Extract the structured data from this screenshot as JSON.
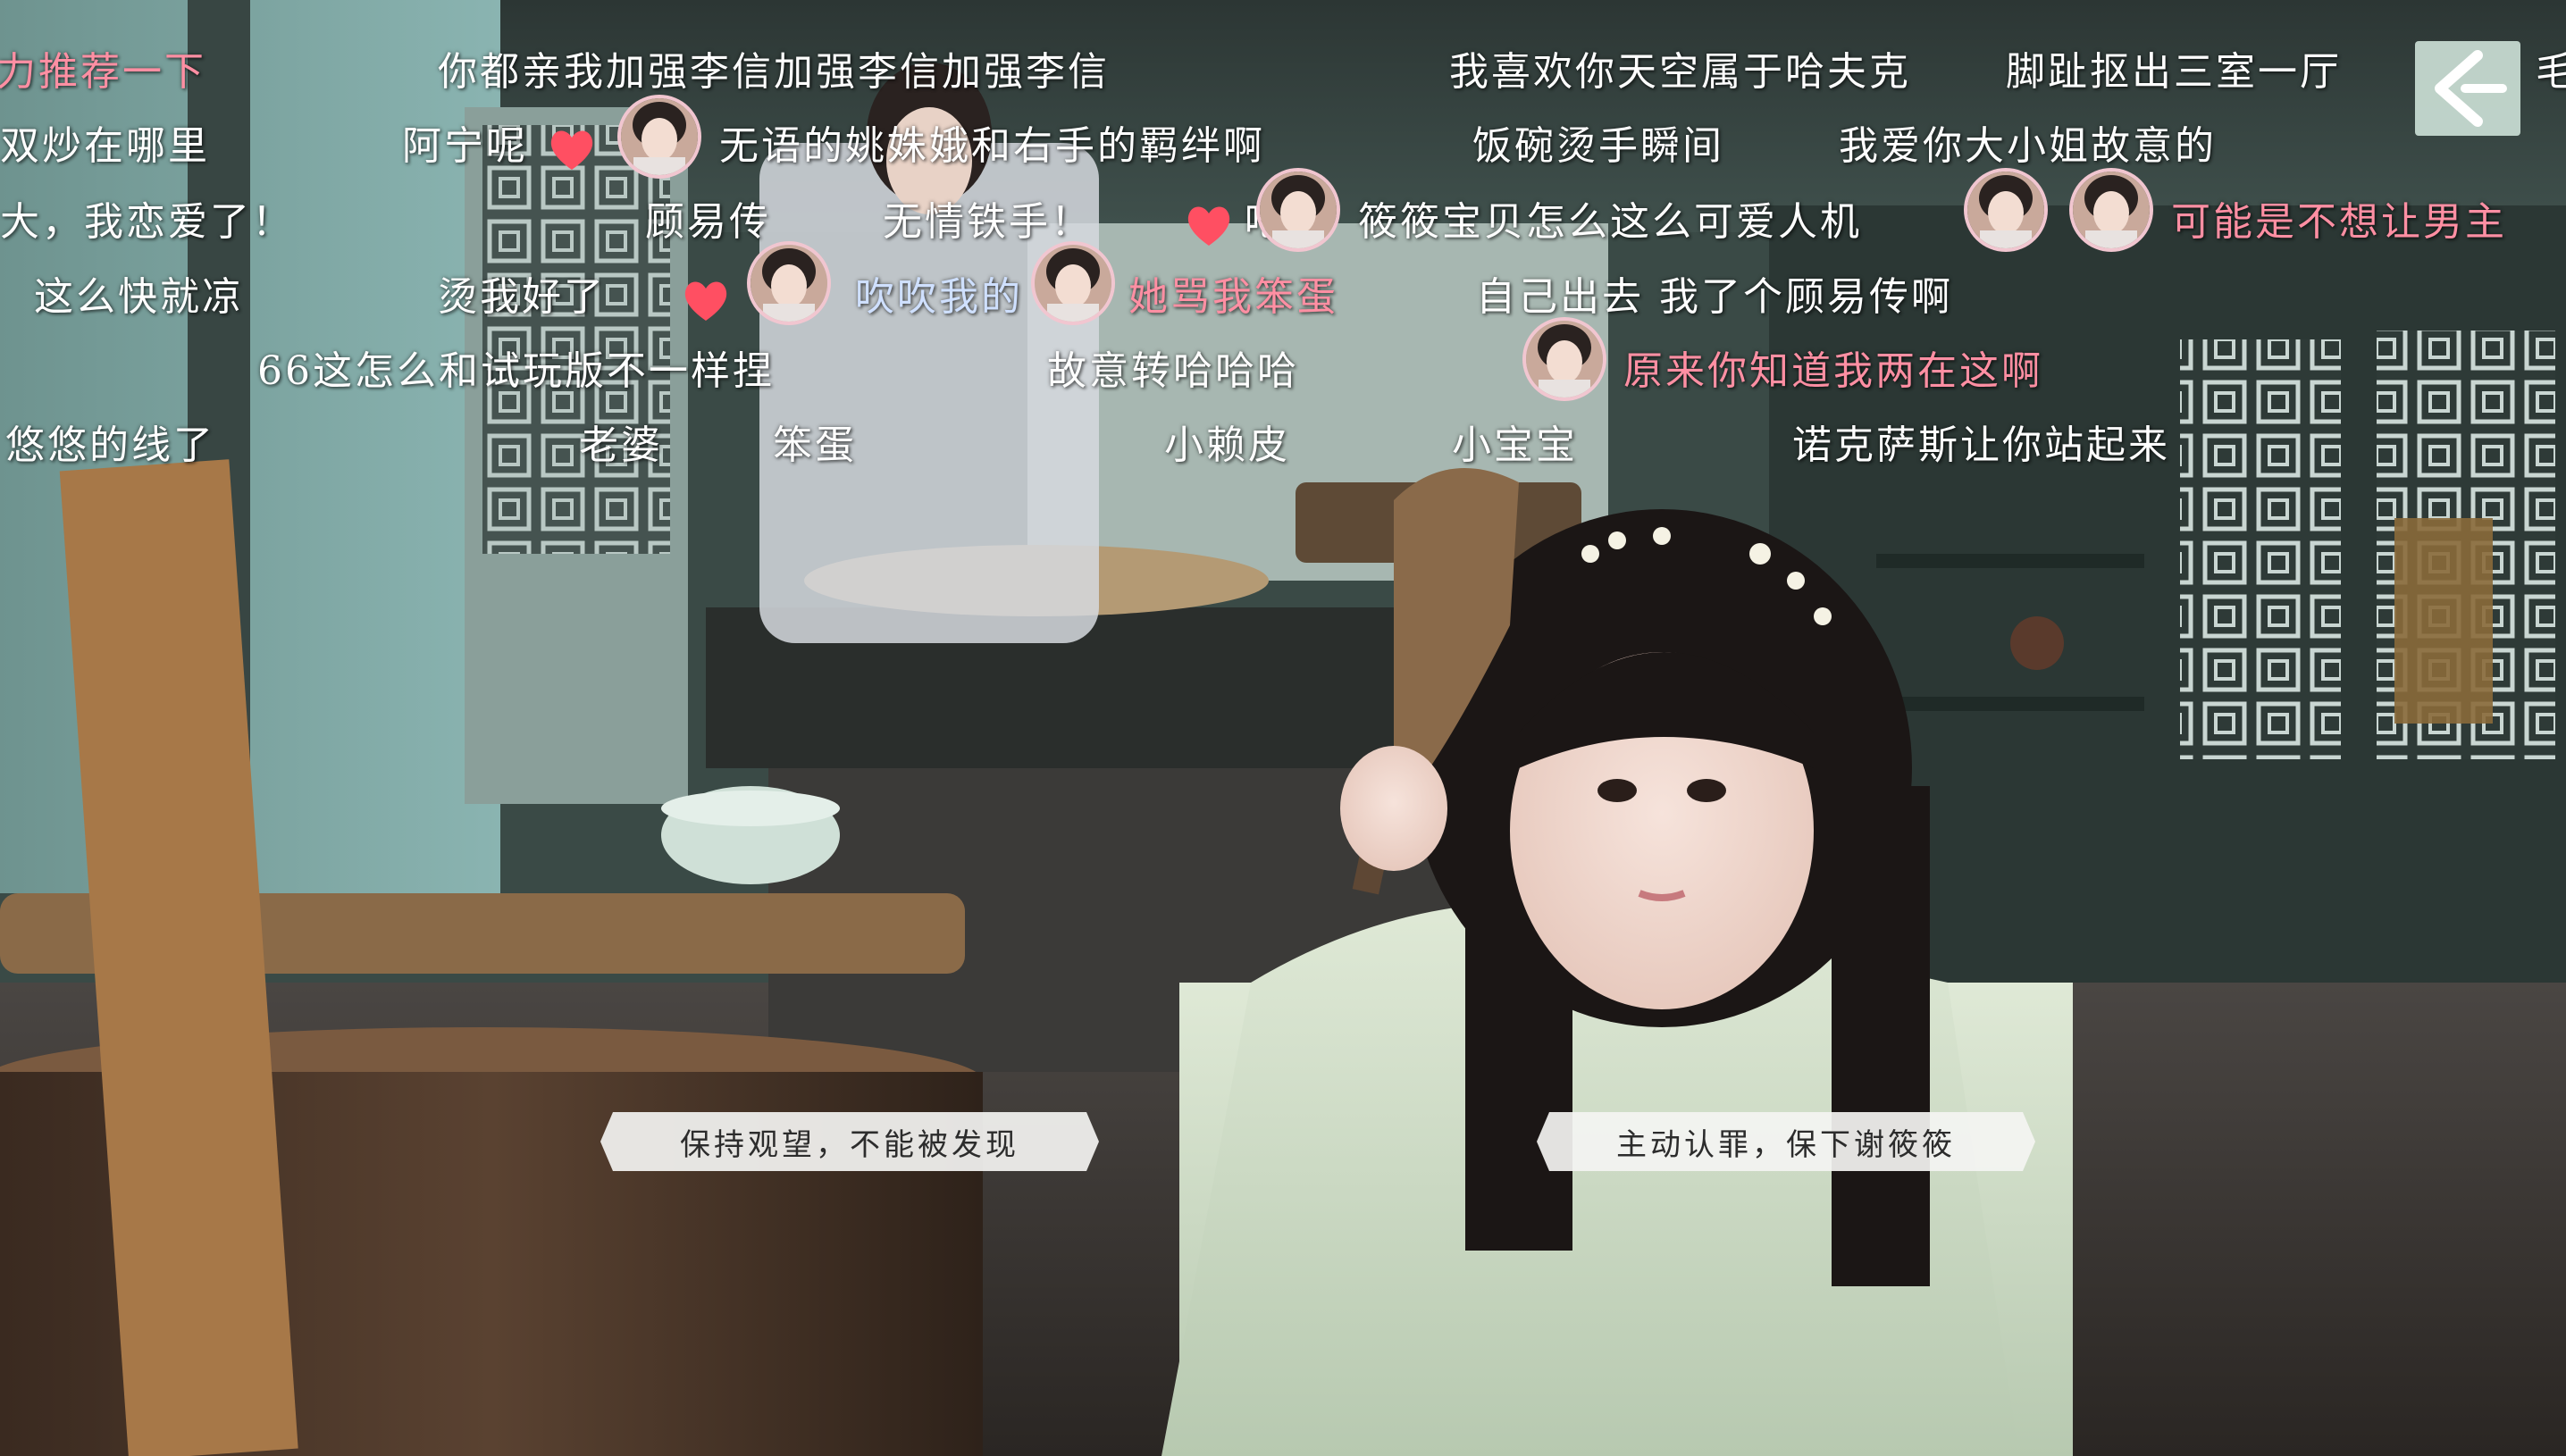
{
  "danmaku": [
    {
      "id": "d1",
      "text": "力推荐一下",
      "style": "pink"
    },
    {
      "id": "d2",
      "text": "你都亲我加强李信加强李信加强李信",
      "style": "white"
    },
    {
      "id": "d3",
      "text": "我喜欢你天空属于哈夫克",
      "style": "white"
    },
    {
      "id": "d4",
      "text": "脚趾抠出三室一厅",
      "style": "white"
    },
    {
      "id": "d5",
      "text": "毛的",
      "style": "white"
    },
    {
      "id": "d6",
      "text": "双炒在哪里",
      "style": "white"
    },
    {
      "id": "d7",
      "text": "阿宁呢",
      "style": "white"
    },
    {
      "id": "d8",
      "text": "无语的姚姝娥和右手的羁绊啊",
      "style": "white"
    },
    {
      "id": "d9",
      "text": "饭碗烫手瞬间",
      "style": "white"
    },
    {
      "id": "d10",
      "text": "我爱你大小姐故意的",
      "style": "white"
    },
    {
      "id": "d11",
      "text": "大，我恋爱了！",
      "style": "white"
    },
    {
      "id": "d12",
      "text": "顾易传",
      "style": "white"
    },
    {
      "id": "d13",
      "text": "无情铁手！",
      "style": "white"
    },
    {
      "id": "d14",
      "text": "吔",
      "style": "white"
    },
    {
      "id": "d15",
      "text": "筱筱宝贝怎么这么可爱人机",
      "style": "white"
    },
    {
      "id": "d16",
      "text": "可能是不想让男主",
      "style": "pink"
    },
    {
      "id": "d17",
      "text": "这么快就凉",
      "style": "white"
    },
    {
      "id": "d18",
      "text": "烫我好了",
      "style": "white"
    },
    {
      "id": "d19",
      "text": "吹吹我的",
      "style": "blue"
    },
    {
      "id": "d20",
      "text": "她骂我笨蛋",
      "style": "pink"
    },
    {
      "id": "d21",
      "text": "自己出去 我了个顾易传啊",
      "style": "white"
    },
    {
      "id": "d22",
      "text": "66这怎么和试玩版不一样捏",
      "style": "white"
    },
    {
      "id": "d23",
      "text": "故意转哈哈哈",
      "style": "white"
    },
    {
      "id": "d24",
      "text": "原来你知道我两在这啊",
      "style": "pink"
    },
    {
      "id": "d25",
      "text": "悠悠的线了",
      "style": "white"
    },
    {
      "id": "d26",
      "text": "老婆",
      "style": "white"
    },
    {
      "id": "d27",
      "text": "笨蛋",
      "style": "white"
    },
    {
      "id": "d28",
      "text": "小赖皮",
      "style": "white"
    },
    {
      "id": "d29",
      "text": "小宝宝",
      "style": "white"
    },
    {
      "id": "d30",
      "text": "诺克萨斯让你站起来",
      "style": "white"
    }
  ],
  "choices": {
    "left": "保持观望，不能被发现",
    "right": "主动认罪，保下谢筱筱"
  },
  "ui": {
    "back_icon": "back-arrow-icon",
    "accent": "#d3e6dc"
  }
}
